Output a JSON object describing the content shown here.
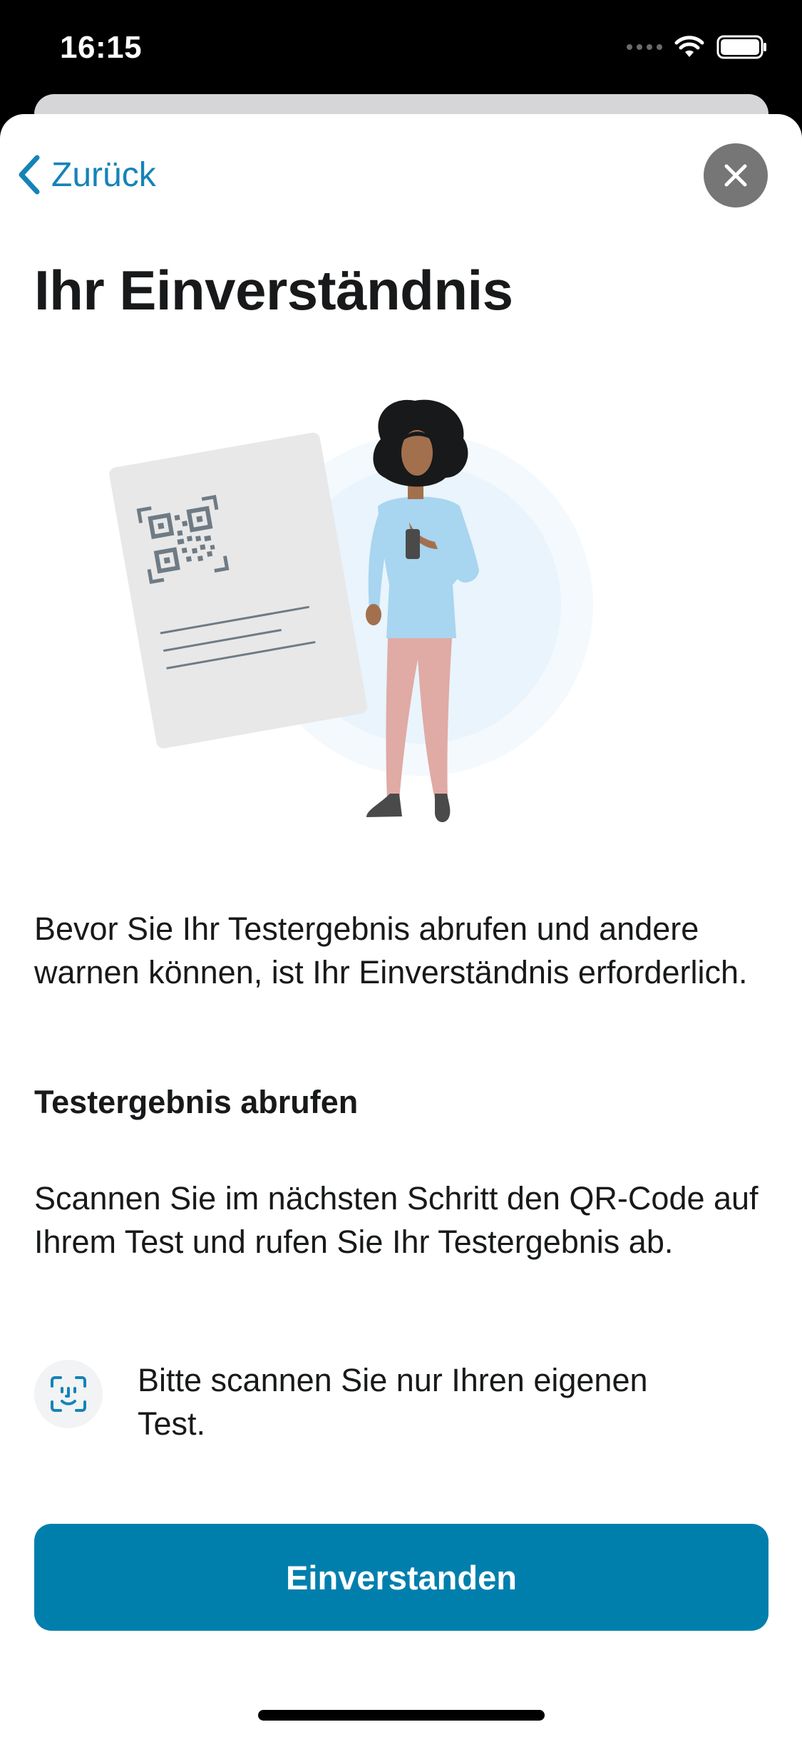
{
  "status_bar": {
    "time": "16:15"
  },
  "navigation": {
    "back_label": "Zurück"
  },
  "title": "Ihr Einverständnis",
  "content": {
    "intro": "Bevor Sie Ihr Testergebnis abrufen und andere warnen können, ist Ihr Einverständnis erforderlich.",
    "section_heading": "Testergebnis abrufen",
    "scan_text": "Scannen Sie im nächsten Schritt den QR-Code auf Ihrem Test und rufen Sie Ihr Testergebnis ab.",
    "notice": "Bitte scannen Sie nur Ihren eigenen Test."
  },
  "actions": {
    "primary_label": "Einverstanden"
  },
  "colors": {
    "accent": "#007fad",
    "link": "#1583b8",
    "text": "#17191a",
    "close_button": "#767676"
  },
  "icons": {
    "back": "chevron-left-icon",
    "close": "close-icon",
    "notice": "face-scan-icon"
  }
}
